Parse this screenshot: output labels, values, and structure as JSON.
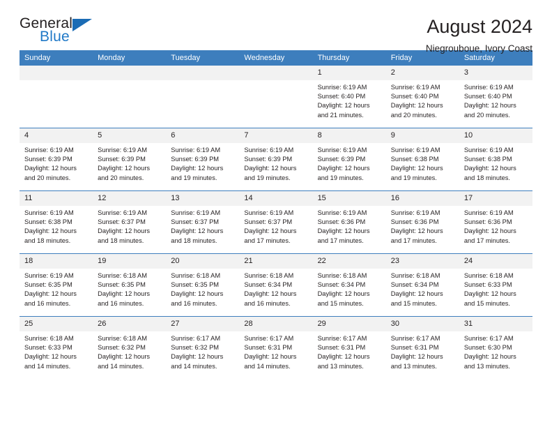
{
  "brand": {
    "name_dark": "General",
    "name_blue": "Blue",
    "triangle_icon": "triangle-icon",
    "accent_color": "#2079c7"
  },
  "header": {
    "title": "August 2024",
    "subtitle": "Niegrouboue, Ivory Coast"
  },
  "theme": {
    "header_bar": "#3d7ebd",
    "daynum_bg": "#f2f2f2",
    "text": "#231f20"
  },
  "weekdays": [
    "Sunday",
    "Monday",
    "Tuesday",
    "Wednesday",
    "Thursday",
    "Friday",
    "Saturday"
  ],
  "labels": {
    "sunrise_prefix": "Sunrise: ",
    "sunset_prefix": "Sunset: ",
    "daylight_prefix": "Daylight: "
  },
  "weeks": [
    [
      {
        "day": "",
        "empty": true
      },
      {
        "day": "",
        "empty": true
      },
      {
        "day": "",
        "empty": true
      },
      {
        "day": "",
        "empty": true
      },
      {
        "day": "1",
        "sunrise": "Sunrise: 6:19 AM",
        "sunset": "Sunset: 6:40 PM",
        "daylight": "Daylight: 12 hours and 21 minutes."
      },
      {
        "day": "2",
        "sunrise": "Sunrise: 6:19 AM",
        "sunset": "Sunset: 6:40 PM",
        "daylight": "Daylight: 12 hours and 20 minutes."
      },
      {
        "day": "3",
        "sunrise": "Sunrise: 6:19 AM",
        "sunset": "Sunset: 6:40 PM",
        "daylight": "Daylight: 12 hours and 20 minutes."
      }
    ],
    [
      {
        "day": "4",
        "sunrise": "Sunrise: 6:19 AM",
        "sunset": "Sunset: 6:39 PM",
        "daylight": "Daylight: 12 hours and 20 minutes."
      },
      {
        "day": "5",
        "sunrise": "Sunrise: 6:19 AM",
        "sunset": "Sunset: 6:39 PM",
        "daylight": "Daylight: 12 hours and 20 minutes."
      },
      {
        "day": "6",
        "sunrise": "Sunrise: 6:19 AM",
        "sunset": "Sunset: 6:39 PM",
        "daylight": "Daylight: 12 hours and 19 minutes."
      },
      {
        "day": "7",
        "sunrise": "Sunrise: 6:19 AM",
        "sunset": "Sunset: 6:39 PM",
        "daylight": "Daylight: 12 hours and 19 minutes."
      },
      {
        "day": "8",
        "sunrise": "Sunrise: 6:19 AM",
        "sunset": "Sunset: 6:39 PM",
        "daylight": "Daylight: 12 hours and 19 minutes."
      },
      {
        "day": "9",
        "sunrise": "Sunrise: 6:19 AM",
        "sunset": "Sunset: 6:38 PM",
        "daylight": "Daylight: 12 hours and 19 minutes."
      },
      {
        "day": "10",
        "sunrise": "Sunrise: 6:19 AM",
        "sunset": "Sunset: 6:38 PM",
        "daylight": "Daylight: 12 hours and 18 minutes."
      }
    ],
    [
      {
        "day": "11",
        "sunrise": "Sunrise: 6:19 AM",
        "sunset": "Sunset: 6:38 PM",
        "daylight": "Daylight: 12 hours and 18 minutes."
      },
      {
        "day": "12",
        "sunrise": "Sunrise: 6:19 AM",
        "sunset": "Sunset: 6:37 PM",
        "daylight": "Daylight: 12 hours and 18 minutes."
      },
      {
        "day": "13",
        "sunrise": "Sunrise: 6:19 AM",
        "sunset": "Sunset: 6:37 PM",
        "daylight": "Daylight: 12 hours and 18 minutes."
      },
      {
        "day": "14",
        "sunrise": "Sunrise: 6:19 AM",
        "sunset": "Sunset: 6:37 PM",
        "daylight": "Daylight: 12 hours and 17 minutes."
      },
      {
        "day": "15",
        "sunrise": "Sunrise: 6:19 AM",
        "sunset": "Sunset: 6:36 PM",
        "daylight": "Daylight: 12 hours and 17 minutes."
      },
      {
        "day": "16",
        "sunrise": "Sunrise: 6:19 AM",
        "sunset": "Sunset: 6:36 PM",
        "daylight": "Daylight: 12 hours and 17 minutes."
      },
      {
        "day": "17",
        "sunrise": "Sunrise: 6:19 AM",
        "sunset": "Sunset: 6:36 PM",
        "daylight": "Daylight: 12 hours and 17 minutes."
      }
    ],
    [
      {
        "day": "18",
        "sunrise": "Sunrise: 6:19 AM",
        "sunset": "Sunset: 6:35 PM",
        "daylight": "Daylight: 12 hours and 16 minutes."
      },
      {
        "day": "19",
        "sunrise": "Sunrise: 6:18 AM",
        "sunset": "Sunset: 6:35 PM",
        "daylight": "Daylight: 12 hours and 16 minutes."
      },
      {
        "day": "20",
        "sunrise": "Sunrise: 6:18 AM",
        "sunset": "Sunset: 6:35 PM",
        "daylight": "Daylight: 12 hours and 16 minutes."
      },
      {
        "day": "21",
        "sunrise": "Sunrise: 6:18 AM",
        "sunset": "Sunset: 6:34 PM",
        "daylight": "Daylight: 12 hours and 16 minutes."
      },
      {
        "day": "22",
        "sunrise": "Sunrise: 6:18 AM",
        "sunset": "Sunset: 6:34 PM",
        "daylight": "Daylight: 12 hours and 15 minutes."
      },
      {
        "day": "23",
        "sunrise": "Sunrise: 6:18 AM",
        "sunset": "Sunset: 6:34 PM",
        "daylight": "Daylight: 12 hours and 15 minutes."
      },
      {
        "day": "24",
        "sunrise": "Sunrise: 6:18 AM",
        "sunset": "Sunset: 6:33 PM",
        "daylight": "Daylight: 12 hours and 15 minutes."
      }
    ],
    [
      {
        "day": "25",
        "sunrise": "Sunrise: 6:18 AM",
        "sunset": "Sunset: 6:33 PM",
        "daylight": "Daylight: 12 hours and 14 minutes."
      },
      {
        "day": "26",
        "sunrise": "Sunrise: 6:18 AM",
        "sunset": "Sunset: 6:32 PM",
        "daylight": "Daylight: 12 hours and 14 minutes."
      },
      {
        "day": "27",
        "sunrise": "Sunrise: 6:17 AM",
        "sunset": "Sunset: 6:32 PM",
        "daylight": "Daylight: 12 hours and 14 minutes."
      },
      {
        "day": "28",
        "sunrise": "Sunrise: 6:17 AM",
        "sunset": "Sunset: 6:31 PM",
        "daylight": "Daylight: 12 hours and 14 minutes."
      },
      {
        "day": "29",
        "sunrise": "Sunrise: 6:17 AM",
        "sunset": "Sunset: 6:31 PM",
        "daylight": "Daylight: 12 hours and 13 minutes."
      },
      {
        "day": "30",
        "sunrise": "Sunrise: 6:17 AM",
        "sunset": "Sunset: 6:31 PM",
        "daylight": "Daylight: 12 hours and 13 minutes."
      },
      {
        "day": "31",
        "sunrise": "Sunrise: 6:17 AM",
        "sunset": "Sunset: 6:30 PM",
        "daylight": "Daylight: 12 hours and 13 minutes."
      }
    ]
  ]
}
